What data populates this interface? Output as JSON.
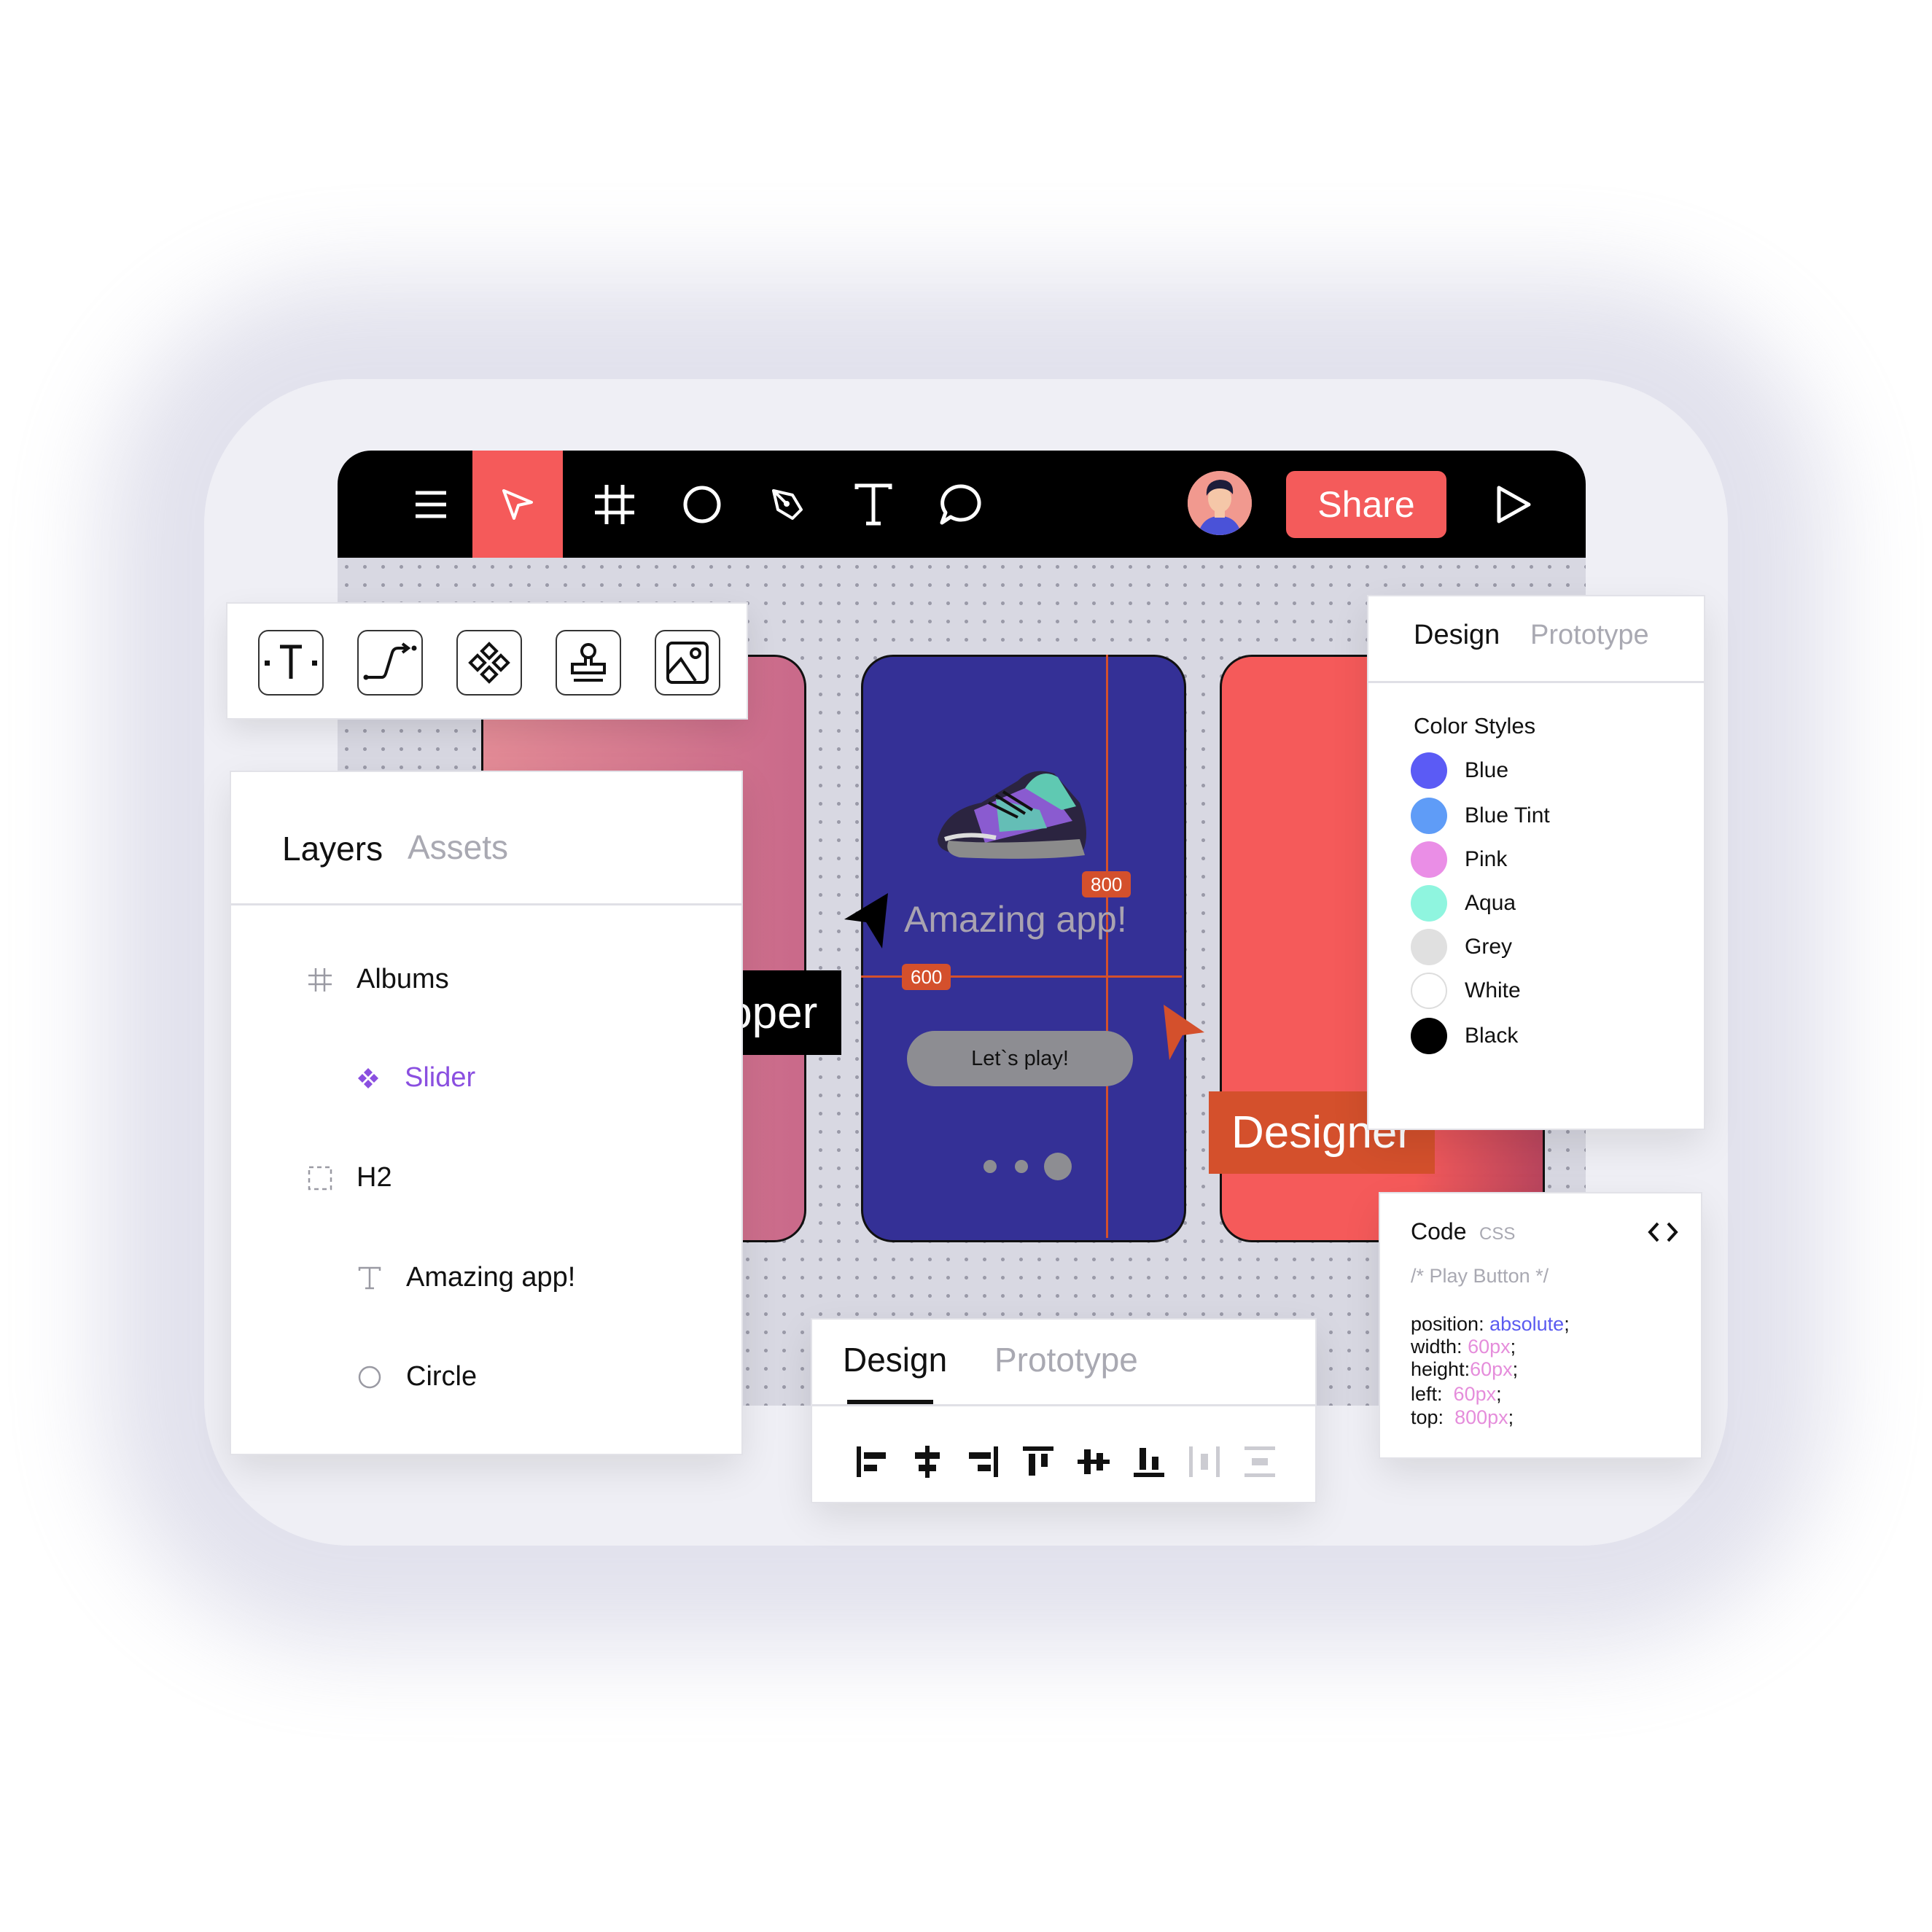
{
  "toolbar": {
    "share_label": "Share",
    "active_tool": "move",
    "tools": [
      "menu-icon",
      "move-icon",
      "frame-icon",
      "ellipse-icon",
      "pen-icon",
      "text-icon",
      "comment-icon"
    ]
  },
  "tool_palette": {
    "tools": [
      "text-tool-icon",
      "connector-tool-icon",
      "component-tool-icon",
      "stamp-tool-icon",
      "image-tool-icon"
    ]
  },
  "layers_panel": {
    "tabs": [
      "Layers",
      "Assets"
    ],
    "active_tab": "Layers",
    "items": [
      {
        "icon": "frame-icon",
        "label": "Albums",
        "color": "#111111"
      },
      {
        "icon": "component-icon",
        "label": "Slider",
        "color": "#8a4fe0"
      },
      {
        "icon": "dashed-box-icon",
        "label": "H2",
        "color": "#111111"
      },
      {
        "icon": "text-icon",
        "label": "Amazing app!",
        "color": "#111111"
      },
      {
        "icon": "circle-icon",
        "label": "Circle",
        "color": "#111111"
      }
    ]
  },
  "canvas": {
    "phone": {
      "title": "Amazing app!",
      "button_label": "Let`s play!",
      "background": "#343096",
      "page_dots": 3,
      "active_dot": 3
    },
    "measure_badges": [
      "800",
      "600"
    ],
    "collaborators": {
      "developer_label": "Developer",
      "designer_label": "Designer"
    }
  },
  "design_panel": {
    "tabs": [
      "Design",
      "Prototype"
    ],
    "active_tab": "Design",
    "section_title": "Color Styles",
    "colors": [
      {
        "name": "Blue",
        "hex": "#5b5bf5"
      },
      {
        "name": "Blue Tint",
        "hex": "#5f9cf7"
      },
      {
        "name": "Pink",
        "hex": "#ea8ee6"
      },
      {
        "name": "Aqua",
        "hex": "#8ff5df"
      },
      {
        "name": "Grey",
        "hex": "#e0e0e0"
      },
      {
        "name": "White",
        "hex": "#ffffff"
      },
      {
        "name": "Black",
        "hex": "#000000"
      }
    ]
  },
  "code_panel": {
    "title": "Code",
    "language": "CSS",
    "comment": "/* Play Button */",
    "lines": [
      {
        "prop": "position:",
        "value": "absolute",
        "value_style": "keyword"
      },
      {
        "prop": "width:",
        "value": "60px",
        "value_style": "value"
      },
      {
        "prop": "height:",
        "value": "60px",
        "value_style": "value"
      },
      {
        "prop": "left:",
        "value": "60px",
        "value_style": "value"
      },
      {
        "prop": "top:",
        "value": "800px",
        "value_style": "value"
      }
    ]
  },
  "bottom_panel": {
    "tabs": [
      "Design",
      "Prototype"
    ],
    "active_tab": "Design",
    "align_tools": [
      "align-left-icon",
      "align-center-h-icon",
      "align-right-icon",
      "align-top-icon",
      "align-middle-v-icon",
      "align-bottom-icon",
      "distribute-h-icon",
      "distribute-v-icon"
    ],
    "disabled_tools": [
      "distribute-h-icon",
      "distribute-v-icon"
    ]
  },
  "colors": {
    "accent": "#f55a5a",
    "orange": "#d4502c",
    "purple": "#8a4fe0"
  }
}
